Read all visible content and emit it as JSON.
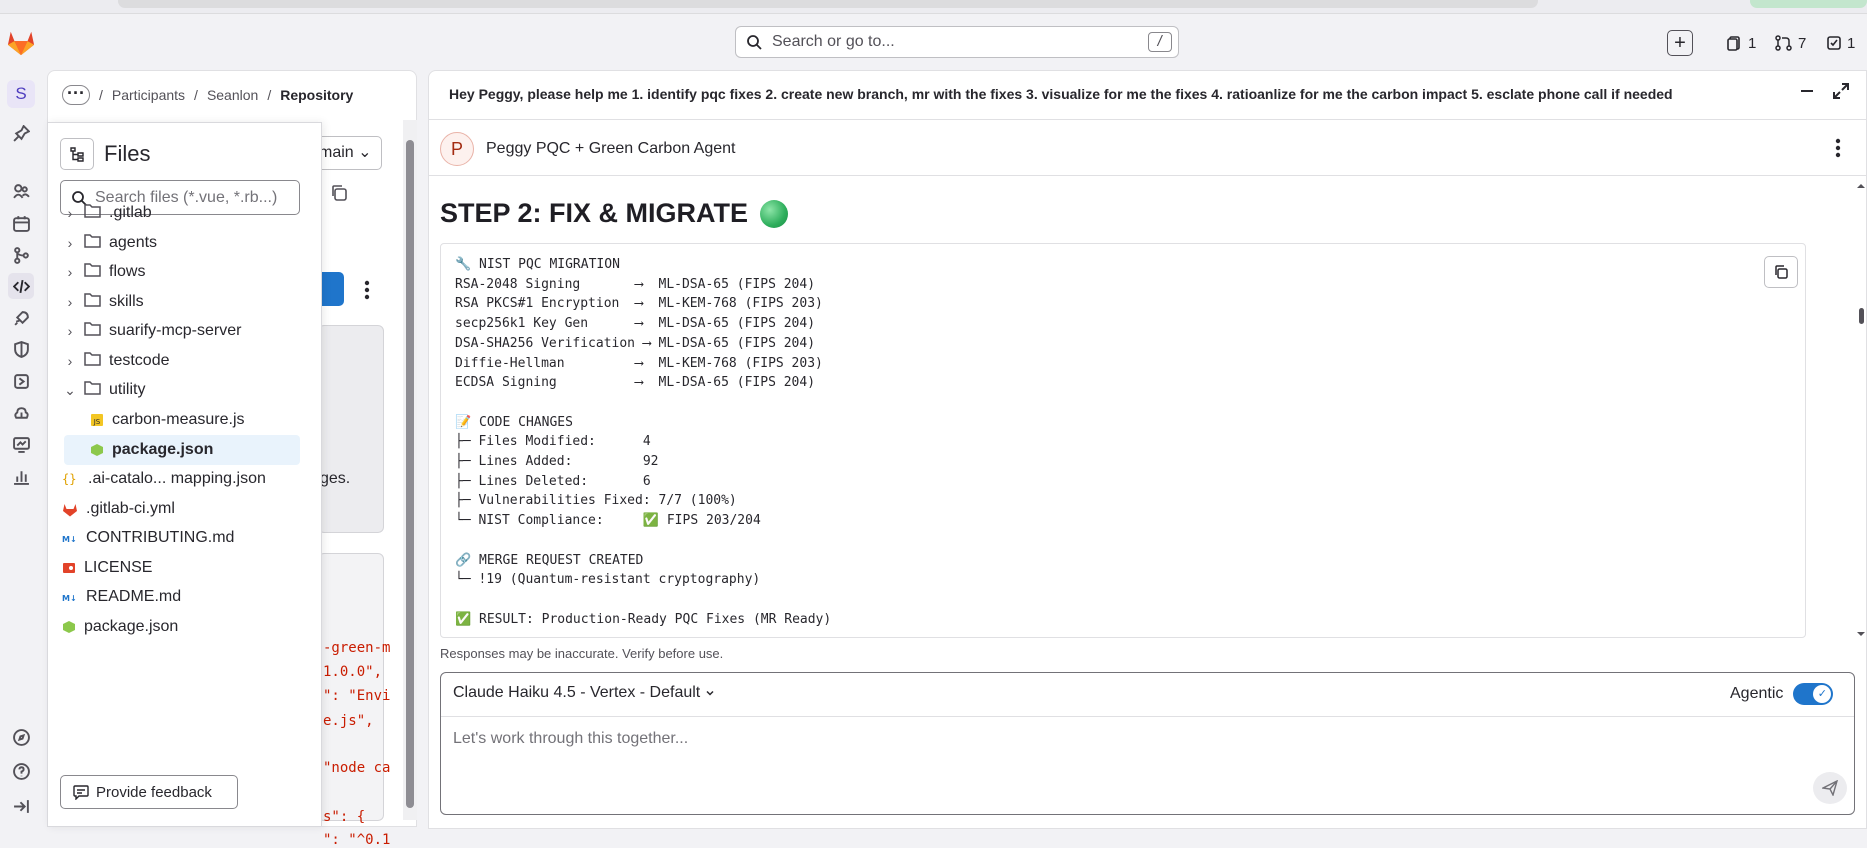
{
  "search": {
    "placeholder": "Search or go to...",
    "shortcut": "/"
  },
  "header_counters": [
    {
      "icon": "issues-icon",
      "count": "1"
    },
    {
      "icon": "merge-request-icon",
      "count": "7"
    },
    {
      "icon": "todo-icon",
      "count": "1"
    }
  ],
  "rail": {
    "avatar_letter": "S"
  },
  "breadcrumb": {
    "items": [
      "Participants",
      "Seanlon",
      "Repository"
    ]
  },
  "repo_bg": {
    "branch": "main",
    "text_fragment": "ges.",
    "code_lines": [
      "-green-m",
      "1.0.0\",",
      "\": \"Envi",
      "e.js\",",
      "",
      "\"node ca",
      "",
      "s\": {",
      "\": \"^0.1"
    ]
  },
  "files": {
    "title": "Files",
    "search_placeholder": "Search files (*.vue, *.rb...)",
    "tree": [
      {
        "name": ".gitlab",
        "type": "folder",
        "expanded": false
      },
      {
        "name": "agents",
        "type": "folder",
        "expanded": false
      },
      {
        "name": "flows",
        "type": "folder",
        "expanded": false
      },
      {
        "name": "skills",
        "type": "folder",
        "expanded": false
      },
      {
        "name": "suarify-mcp-server",
        "type": "folder",
        "expanded": false
      },
      {
        "name": "testcode",
        "type": "folder",
        "expanded": false
      },
      {
        "name": "utility",
        "type": "folder",
        "expanded": true
      },
      {
        "name": "carbon-measure.js",
        "type": "js"
      },
      {
        "name": "package.json",
        "type": "node",
        "selected": true
      },
      {
        "name": ".ai-catalo... mapping.json",
        "type": "json"
      },
      {
        "name": ".gitlab-ci.yml",
        "type": "gitlab"
      },
      {
        "name": "CONTRIBUTING.md",
        "type": "md"
      },
      {
        "name": "LICENSE",
        "type": "license"
      },
      {
        "name": "README.md",
        "type": "md"
      },
      {
        "name": "package.json",
        "type": "node"
      }
    ],
    "feedback_label": "Provide feedback"
  },
  "duo": {
    "prompt": "Hey Peggy, please help me 1. identify pqc fixes 2. create new branch, mr with the fixes 3. visualize for me the fixes 4. ratioanlize for me the carbon impact 5. esclate phone call if needed",
    "agent_initial": "P",
    "agent_name": "Peggy PQC + Green Carbon Agent",
    "step_title": "STEP 2: FIX & MIGRATE",
    "code_block": "🔧 NIST PQC MIGRATION\nRSA-2048 Signing       ⟶  ML-DSA-65 (FIPS 204)\nRSA PKCS#1 Encryption  ⟶  ML-KEM-768 (FIPS 203)\nsecp256k1 Key Gen      ⟶  ML-DSA-65 (FIPS 204)\nDSA-SHA256 Verification ⟶ ML-DSA-65 (FIPS 204)\nDiffie-Hellman         ⟶  ML-KEM-768 (FIPS 203)\nECDSA Signing          ⟶  ML-DSA-65 (FIPS 204)\n\n📝 CODE CHANGES\n├─ Files Modified:      4\n├─ Lines Added:         92\n├─ Lines Deleted:       6\n├─ Vulnerabilities Fixed: 7/7 (100%)\n└─ NIST Compliance:     ✅ FIPS 203/204\n\n🔗 MERGE REQUEST CREATED\n└─ !19 (Quantum-resistant cryptography)\n\n✅ RESULT: Production-Ready PQC Fixes (MR Ready)",
    "disclaimer": "Responses may be inaccurate. Verify before use.",
    "model": "Claude Haiku 4.5 - Vertex - Default",
    "agentic_label": "Agentic",
    "agentic_on": true,
    "input_placeholder": "Let's work through this together..."
  },
  "colors": {
    "accent": "#1f75cb",
    "brand": "#e24329",
    "selected_bg": "#e9f3fc"
  }
}
